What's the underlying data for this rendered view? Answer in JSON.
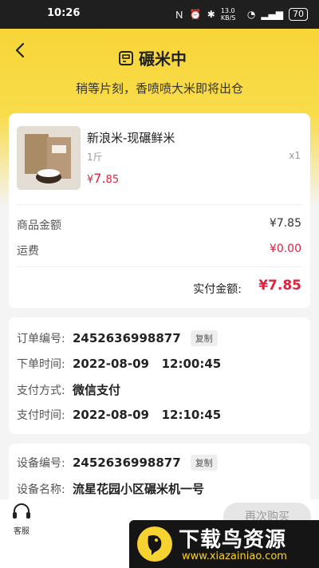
{
  "status_bar": {
    "time": "10:26",
    "network": "13.0 KB/S",
    "battery": "70"
  },
  "header": {
    "title": "碾米中",
    "subtitle": "稍等片刻，香喷喷大米即将出仓"
  },
  "product": {
    "name": "新浪米-现碾鲜米",
    "spec": "1斤",
    "qty": "x1",
    "price_symbol": "¥",
    "price_int": "7.",
    "price_dec": "85"
  },
  "summary": {
    "goods_label": "商品金额",
    "goods_value": "¥7.85",
    "shipping_label": "运费",
    "shipping_value": "¥0.00",
    "paid_label": "实付金额:",
    "paid_value": "¥7.85"
  },
  "order": {
    "no_label": "订单编号:",
    "no_value": "2452636998877",
    "copy": "复制",
    "time_label": "下单时间:",
    "time_value": "2022-08-09   12:00:45",
    "pay_method_label": "支付方式:",
    "pay_method_value": "微信支付",
    "pay_time_label": "支付时间:",
    "pay_time_value": "2022-08-09   12:10:45"
  },
  "device": {
    "no_label": "设备编号:",
    "no_value": "2452636998877",
    "copy": "复制",
    "name_label": "设备名称:",
    "name_value": "流星花园小区碾米机一号"
  },
  "bottom": {
    "cs_label": "客服",
    "again_label": "再次购买"
  },
  "watermark": {
    "title": "下载鸟资源",
    "url": "www.xiazainiao.com"
  },
  "colors": {
    "accent": "#f7d332",
    "price_red": "#e0223d"
  }
}
